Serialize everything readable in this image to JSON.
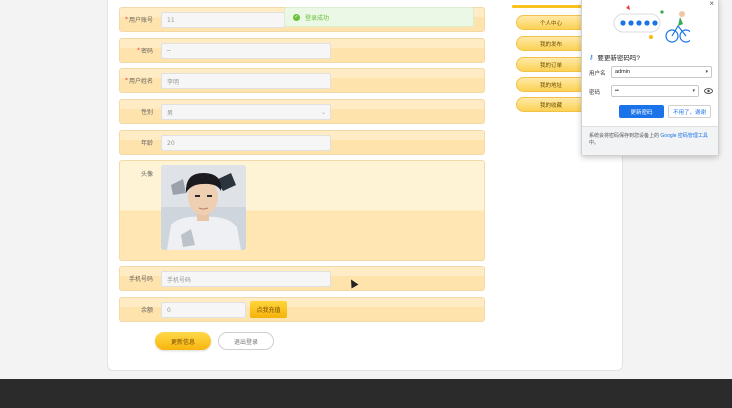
{
  "toast": {
    "message": "登录成功"
  },
  "form": {
    "account": {
      "label": "用户账号",
      "value": "11"
    },
    "password": {
      "label": "密码",
      "value": "··"
    },
    "username": {
      "label": "用户姓名",
      "value": "李明"
    },
    "gender": {
      "label": "性别",
      "value": "男"
    },
    "age": {
      "label": "年龄",
      "value": "20"
    },
    "avatar": {
      "label": "头像"
    },
    "phone": {
      "label": "手机号码",
      "placeholder": "手机号码"
    },
    "balance": {
      "label": "余额",
      "value": "0",
      "recharge_label": "点我充值"
    },
    "update_label": "更新信息",
    "logout_label": "退出登录"
  },
  "sidebar": {
    "items": [
      {
        "label": "个人中心"
      },
      {
        "label": "我的发布"
      },
      {
        "label": "我的订单"
      },
      {
        "label": "我的地址"
      },
      {
        "label": "我的收藏"
      }
    ]
  },
  "password_popup": {
    "title": "要更新密码吗?",
    "username_label": "用户名",
    "username_value": "admin",
    "password_label": "密码",
    "password_value": "••",
    "update_button": "更新密码",
    "no_button": "不用了，谢谢",
    "footer_text": "系统会将密码保存到您设备上的",
    "footer_link": "Google 密码管理工具",
    "footer_end": "中。"
  },
  "colors": {
    "accent": "#f7b40d",
    "row_bg": "#ffecc4",
    "success": "#67c23a",
    "chrome_blue": "#1a73e8",
    "footer": "#2b2b2b"
  }
}
